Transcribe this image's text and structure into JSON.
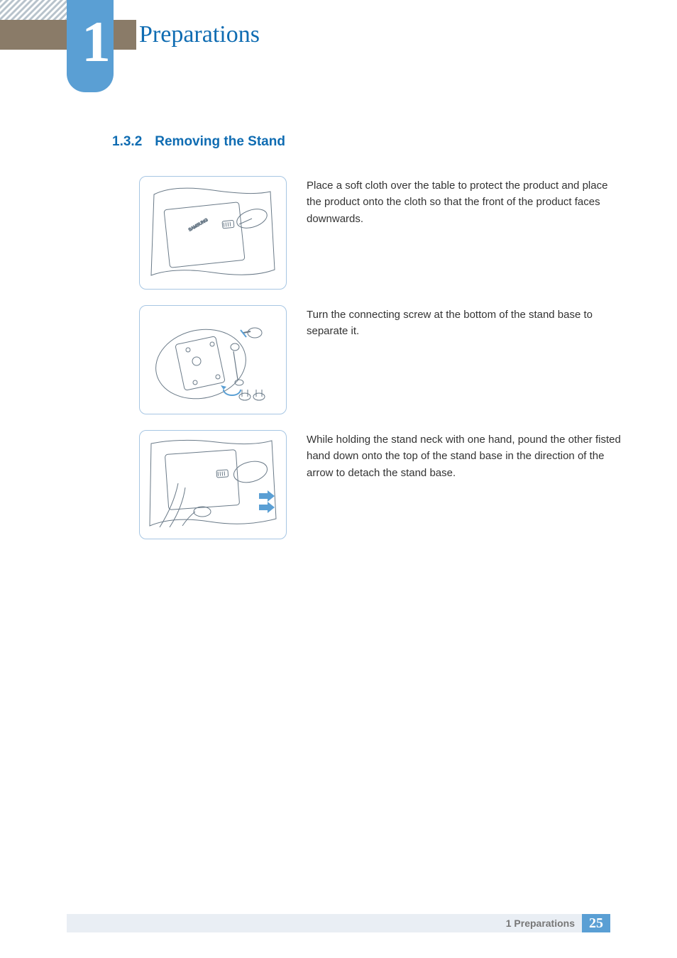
{
  "chapter": {
    "number": "1",
    "title": "Preparations"
  },
  "section": {
    "number": "1.3.2",
    "title": "Removing the Stand"
  },
  "steps": [
    {
      "text": "Place a soft cloth over the table to protect the product and place the product onto the cloth so that the front of the product faces downwards."
    },
    {
      "text": "Turn the connecting screw at the bottom of the stand base to separate it."
    },
    {
      "text": "While holding the stand neck with one hand, pound the other fisted hand down onto the top of the stand base in the direction of the arrow to detach the stand base."
    }
  ],
  "footer": {
    "label": "1 Preparations",
    "page": "25"
  }
}
